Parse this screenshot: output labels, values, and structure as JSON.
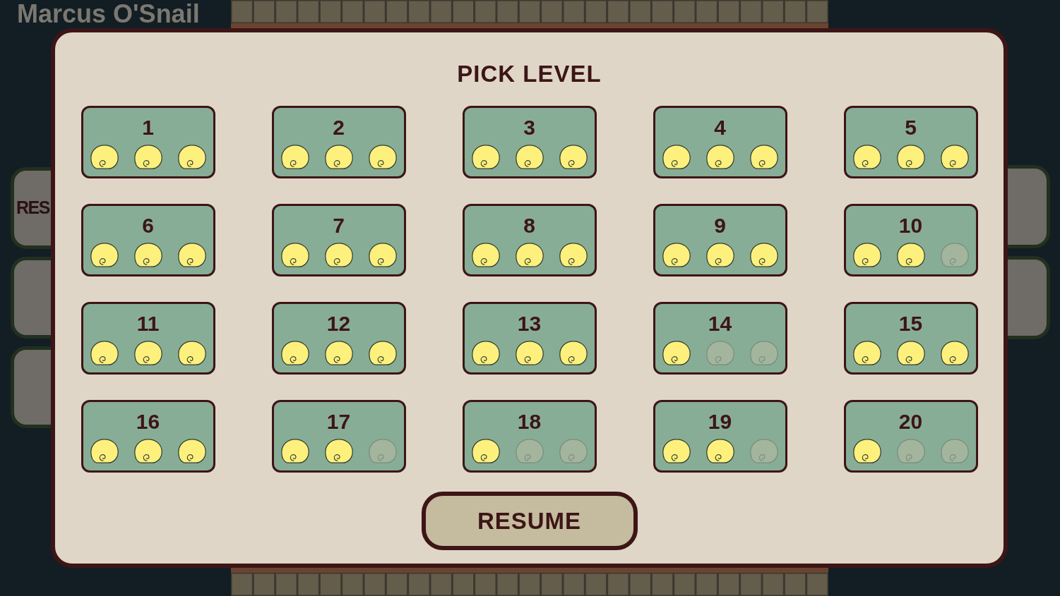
{
  "background": {
    "title": "Marcus O'Snail",
    "side_button": {
      "label": "RES"
    }
  },
  "dialog": {
    "title": "PICK LEVEL",
    "levels": [
      {
        "label": "1",
        "stars": 3
      },
      {
        "label": "2",
        "stars": 3
      },
      {
        "label": "3",
        "stars": 3
      },
      {
        "label": "4",
        "stars": 3
      },
      {
        "label": "5",
        "stars": 3
      },
      {
        "label": "6",
        "stars": 3
      },
      {
        "label": "7",
        "stars": 3
      },
      {
        "label": "8",
        "stars": 3
      },
      {
        "label": "9",
        "stars": 3
      },
      {
        "label": "10",
        "stars": 2
      },
      {
        "label": "11",
        "stars": 3
      },
      {
        "label": "12",
        "stars": 3
      },
      {
        "label": "13",
        "stars": 3
      },
      {
        "label": "14",
        "stars": 1
      },
      {
        "label": "15",
        "stars": 3
      },
      {
        "label": "16",
        "stars": 3
      },
      {
        "label": "17",
        "stars": 2
      },
      {
        "label": "18",
        "stars": 1
      },
      {
        "label": "19",
        "stars": 2
      },
      {
        "label": "20",
        "stars": 1
      }
    ],
    "resume_button": {
      "label": "RESUME"
    }
  }
}
